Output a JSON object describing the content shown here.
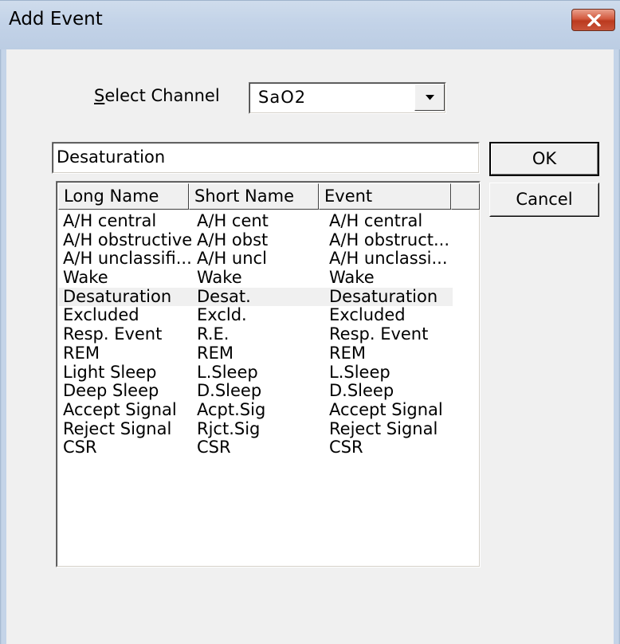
{
  "window": {
    "title": "Add Event"
  },
  "channel": {
    "label_mnemonic": "S",
    "label_rest": "elect Channel",
    "value": "SaO2"
  },
  "event_name": {
    "value": "Desaturation"
  },
  "buttons": {
    "ok": "OK",
    "cancel": "Cancel"
  },
  "list": {
    "headers": [
      "Long Name",
      "Short Name",
      "Event",
      ""
    ],
    "selected_index": 4,
    "rows": [
      [
        "A/H central",
        "A/H cent",
        "A/H central"
      ],
      [
        "A/H obstructive",
        "A/H obst",
        "A/H obstruct..."
      ],
      [
        "A/H unclassifi...",
        "A/H uncl",
        "A/H unclassi..."
      ],
      [
        "Wake",
        "Wake",
        "Wake"
      ],
      [
        "Desaturation",
        "Desat.",
        "Desaturation"
      ],
      [
        "Excluded",
        "Excld.",
        "Excluded"
      ],
      [
        "Resp. Event",
        "R.E.",
        "Resp. Event"
      ],
      [
        "REM",
        "REM",
        "REM"
      ],
      [
        "Light Sleep",
        "L.Sleep",
        "L.Sleep"
      ],
      [
        "Deep Sleep",
        "D.Sleep",
        "D.Sleep"
      ],
      [
        "Accept Signal",
        "Acpt.Sig",
        "Accept Signal"
      ],
      [
        "Reject Signal",
        "Rjct.Sig",
        "Reject Signal"
      ],
      [
        "CSR",
        "CSR",
        "CSR"
      ]
    ]
  },
  "colors": {
    "titlebar": "#c3d3e8",
    "close": "#c9543a",
    "dialog_bg": "#f0f0f0"
  },
  "icons": {
    "close": "close-icon",
    "dropdown": "chevron-down-icon"
  }
}
